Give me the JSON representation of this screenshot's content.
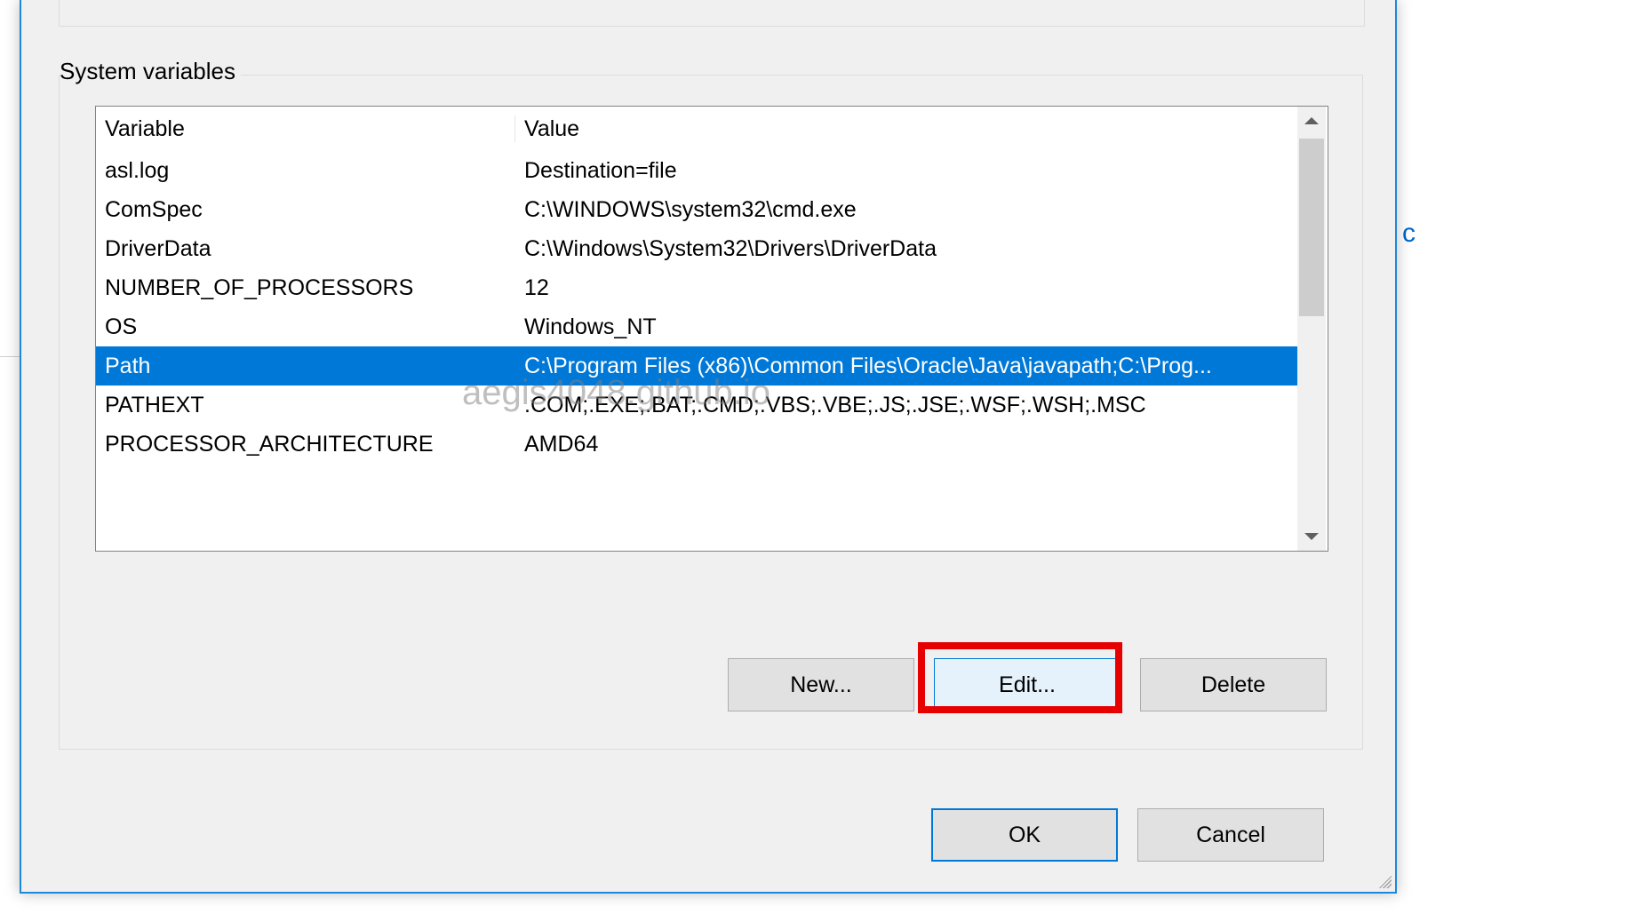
{
  "watermark": "aegis4048.github.io",
  "group": {
    "title": "System variables"
  },
  "columns": {
    "variable": "Variable",
    "value": "Value"
  },
  "rows": [
    {
      "variable": "asl.log",
      "value": "Destination=file",
      "selected": false
    },
    {
      "variable": "ComSpec",
      "value": "C:\\WINDOWS\\system32\\cmd.exe",
      "selected": false
    },
    {
      "variable": "DriverData",
      "value": "C:\\Windows\\System32\\Drivers\\DriverData",
      "selected": false
    },
    {
      "variable": "NUMBER_OF_PROCESSORS",
      "value": "12",
      "selected": false
    },
    {
      "variable": "OS",
      "value": "Windows_NT",
      "selected": false
    },
    {
      "variable": "Path",
      "value": "C:\\Program Files (x86)\\Common Files\\Oracle\\Java\\javapath;C:\\Prog...",
      "selected": true
    },
    {
      "variable": "PATHEXT",
      "value": ".COM;.EXE;.BAT;.CMD;.VBS;.VBE;.JS;.JSE;.WSF;.WSH;.MSC",
      "selected": false
    },
    {
      "variable": "PROCESSOR_ARCHITECTURE",
      "value": "AMD64",
      "selected": false
    }
  ],
  "buttons": {
    "new": "New...",
    "edit": "Edit...",
    "delete": "Delete",
    "ok": "OK",
    "cancel": "Cancel"
  },
  "highlight": "edit",
  "behind_right_fragment": "c"
}
